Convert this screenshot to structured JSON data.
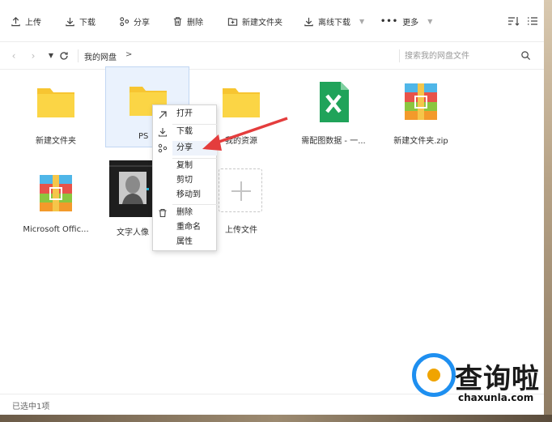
{
  "toolbar": {
    "upload": "上传",
    "download": "下载",
    "share": "分享",
    "delete": "删除",
    "new_folder": "新建文件夹",
    "offline_download": "离线下载",
    "more": "更多"
  },
  "navbar": {
    "breadcrumb": "我的网盘",
    "crumb_arrow": ">",
    "search_placeholder": "搜索我的网盘文件"
  },
  "files": [
    {
      "name": "新建文件夹",
      "icon": "folder-icon"
    },
    {
      "name": "PS",
      "icon": "folder-icon",
      "selected": true
    },
    {
      "name": "我的资源",
      "icon": "folder-icon"
    },
    {
      "name": "需配图数据 - 一...",
      "icon": "excel-icon"
    },
    {
      "name": "新建文件夹.zip",
      "icon": "zip-icon"
    },
    {
      "name": "Microsoft Offic...",
      "icon": "zip-icon"
    },
    {
      "name": "文字人像",
      "icon": "image-thumbnail"
    },
    {
      "name": "上传文件",
      "icon": "plus-icon"
    }
  ],
  "context_menu": {
    "open": "打开",
    "download": "下载",
    "share": "分享",
    "copy": "复制",
    "cut": "剪切",
    "move_to": "移动到",
    "delete": "删除",
    "rename": "重命名",
    "properties": "属性"
  },
  "status": {
    "selected_text": "已选中1项"
  },
  "watermark": {
    "brand": "查询啦",
    "url": "chaxunla.com"
  },
  "colors": {
    "folder": "#f7c531",
    "excel": "#20a35a",
    "selection_bg": "#eaf2fd",
    "arrow": "#e43d3d",
    "brand_blue": "#1e8ff0",
    "brand_orange": "#f0a400"
  }
}
